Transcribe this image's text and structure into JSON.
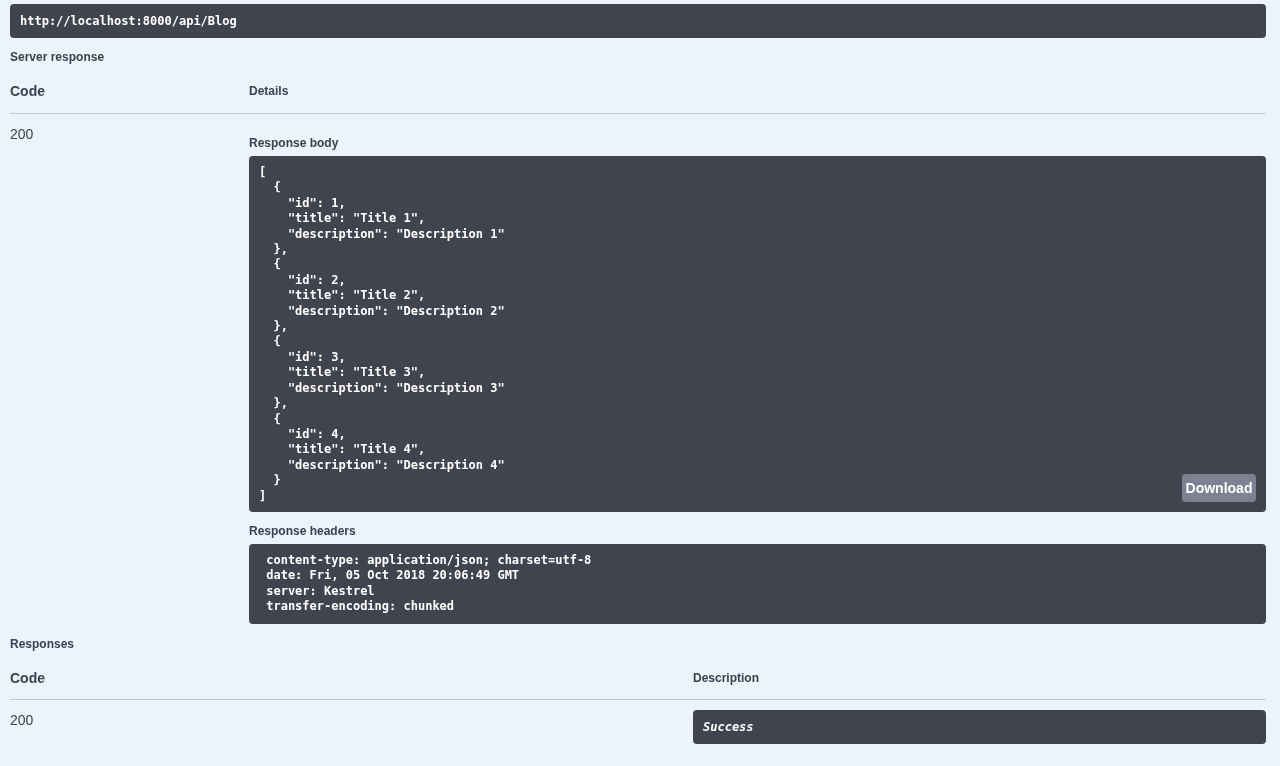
{
  "request_url": "http://localhost:8000/api/Blog",
  "server_response": {
    "title": "Server response",
    "columns": [
      "Code",
      "Details"
    ],
    "rows": [
      {
        "code": "200",
        "response_body": {
          "label": "Response body",
          "content": "[\n  {\n    \"id\": 1,\n    \"title\": \"Title 1\",\n    \"description\": \"Description 1\"\n  },\n  {\n    \"id\": 2,\n    \"title\": \"Title 2\",\n    \"description\": \"Description 2\"\n  },\n  {\n    \"id\": 3,\n    \"title\": \"Title 3\",\n    \"description\": \"Description 3\"\n  },\n  {\n    \"id\": 4,\n    \"title\": \"Title 4\",\n    \"description\": \"Description 4\"\n  }\n]",
          "download_button": "Download"
        },
        "response_headers": {
          "label": "Response headers",
          "content": " content-type: application/json; charset=utf-8 \n date: Fri, 05 Oct 2018 20:06:49 GMT \n server: Kestrel \n transfer-encoding: chunked "
        }
      }
    ]
  },
  "responses": {
    "title": "Responses",
    "columns": [
      "Code",
      "Description"
    ],
    "rows": [
      {
        "code": "200",
        "description": "Success"
      }
    ]
  }
}
